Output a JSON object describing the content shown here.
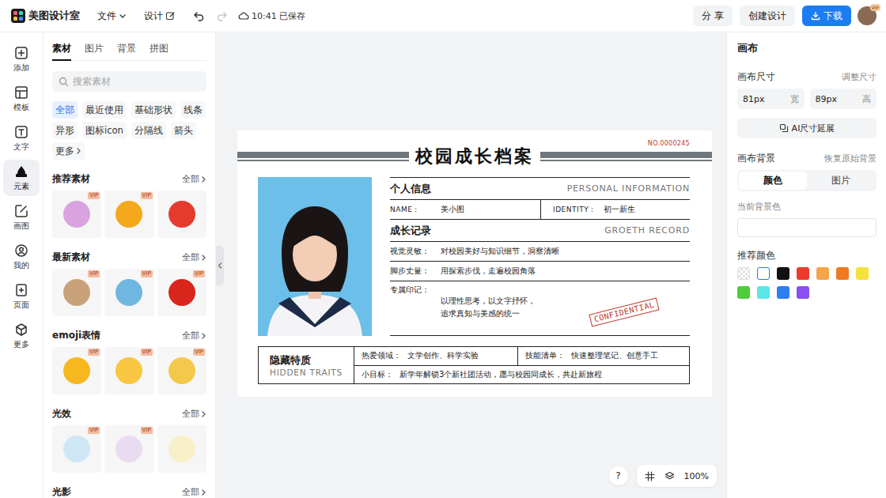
{
  "topbar": {
    "logo": "美图设计室",
    "menus": [
      {
        "label": "文件",
        "kind": "dropdown"
      },
      {
        "label": "设计",
        "kind": "edit"
      }
    ],
    "history": {
      "undo_disabled": false,
      "redo_disabled": true
    },
    "save_status": "10:41 已保存",
    "share": "分 享",
    "create": "创建设计",
    "download": "下载",
    "avatar_badge": "VIP"
  },
  "rail": [
    {
      "label": "添加",
      "selected": false
    },
    {
      "label": "模板",
      "selected": false
    },
    {
      "label": "文字",
      "selected": false
    },
    {
      "label": "元素",
      "selected": true
    },
    {
      "label": "画图",
      "selected": false
    },
    {
      "label": "我的",
      "selected": false
    },
    {
      "label": "页面",
      "selected": false
    },
    {
      "label": "更多",
      "selected": false
    }
  ],
  "panel": {
    "tabs": [
      {
        "label": "素材",
        "selected": true
      },
      {
        "label": "图片",
        "selected": false
      },
      {
        "label": "背景",
        "selected": false
      },
      {
        "label": "拼图",
        "selected": false
      }
    ],
    "search": {
      "placeholder": "搜索素材"
    },
    "chips": [
      {
        "label": "全部",
        "selected": true,
        "kind": "plain"
      },
      {
        "label": "最近使用",
        "selected": false,
        "kind": "plain"
      },
      {
        "label": "基础形状",
        "selected": false,
        "kind": "plain"
      },
      {
        "label": "线条",
        "selected": false,
        "kind": "plain"
      },
      {
        "label": "异形",
        "selected": false,
        "kind": "plain"
      },
      {
        "label": "图标icon",
        "selected": false,
        "kind": "plain"
      },
      {
        "label": "分隔线",
        "selected": false,
        "kind": "plain"
      },
      {
        "label": "箭头",
        "selected": false,
        "kind": "plain"
      },
      {
        "label": "更多",
        "selected": false,
        "kind": "more"
      }
    ],
    "sections": [
      {
        "title": "推荐素材",
        "more": "全部",
        "items": [
          {
            "badge": "VIP",
            "color": "#d9a3e0"
          },
          {
            "badge": "VIP",
            "color": "#f4a81c"
          },
          {
            "badge": null,
            "color": "#e53a2c"
          }
        ]
      },
      {
        "title": "最新素材",
        "more": "全部",
        "items": [
          {
            "badge": "VIP",
            "color": "#c9a27a"
          },
          {
            "badge": "VIP",
            "color": "#6fb7e0"
          },
          {
            "badge": "VIP",
            "color": "#d8261c"
          }
        ]
      },
      {
        "title": "emoji表情",
        "more": "全部",
        "items": [
          {
            "badge": "VIP",
            "color": "#f6b81c"
          },
          {
            "badge": "VIP",
            "color": "#f8c640"
          },
          {
            "badge": "VIP",
            "color": "#f4c84a"
          }
        ]
      },
      {
        "title": "光效",
        "more": "全部",
        "items": [
          {
            "badge": "VIP",
            "color": "#cfe6f5"
          },
          {
            "badge": "VIP",
            "color": "#eadcf0"
          },
          {
            "badge": null,
            "color": "#f7f0c8"
          }
        ]
      },
      {
        "title": "光影",
        "more": "全部",
        "items": [
          {
            "badge": null,
            "color": "#cccccc"
          },
          {
            "badge": null,
            "color": "#dddddd"
          },
          {
            "badge": null,
            "color": "#e0d0b0"
          }
        ]
      }
    ]
  },
  "canvas": {
    "doc": {
      "serial": "NO.0000245",
      "title": "校园成长档案",
      "info": {
        "title": "个人信息",
        "title_en": "PERSONAL INFORMATION",
        "fields": [
          {
            "label": "NAME：",
            "value": "美小图"
          },
          {
            "label": "IDENTITY：",
            "value": "初一新生"
          }
        ]
      },
      "record": {
        "title": "成长记录",
        "title_en": "GROETH RECORD",
        "rows": [
          {
            "label": "视觉灵敏：",
            "kind": "inline",
            "lines": [
              "对校园美好与知识细节，洞察清晰"
            ]
          },
          {
            "label": "脚步丈量：",
            "kind": "inline",
            "lines": [
              "用探索步伐，走遍校园角落"
            ]
          },
          {
            "label": "专属印记：",
            "kind": "block",
            "lines": [
              "以理性思考，以文字抒怀，",
              "追求真知与美感的统一"
            ]
          }
        ]
      },
      "stamp": "CONFIDENTIAL",
      "traits": {
        "title": "隐藏特质",
        "title_en": "HIDDEN TRAITS",
        "cells": [
          {
            "label": "热爱领域：",
            "value": "文学创作、科学实验"
          },
          {
            "label": "技能清单：",
            "value": "快速整理笔记、创意手工"
          },
          {
            "label": "小目标：",
            "value": "新学年解锁3个新社团活动，愿与校园同成长，共赴新旅程"
          }
        ]
      }
    },
    "help": "?",
    "zoom": "100%"
  },
  "inspector": {
    "title": "画布",
    "size": {
      "label": "画布尺寸",
      "action": "调整尺寸",
      "fields": [
        {
          "value": "81px",
          "unit": "宽"
        },
        {
          "value": "89px",
          "unit": "高"
        }
      ]
    },
    "ai_button": "AI尺寸延展",
    "background": {
      "label": "画布背景",
      "action": "恢复原始背景",
      "modes": [
        {
          "label": "颜色",
          "selected": true
        },
        {
          "label": "图片",
          "selected": false
        }
      ],
      "current_label": "当前背景色",
      "recommended_label": "推荐颜色",
      "swatches": [
        {
          "kind": "transparent",
          "color": "#ffffff",
          "selected": false
        },
        {
          "kind": "solid",
          "color": "#ffffff",
          "selected": true
        },
        {
          "kind": "solid",
          "color": "#111111",
          "selected": false
        },
        {
          "kind": "solid",
          "color": "#ee3a2a",
          "selected": false
        },
        {
          "kind": "solid",
          "color": "#f5a54a",
          "selected": false
        },
        {
          "kind": "solid",
          "color": "#f07a22",
          "selected": false
        },
        {
          "kind": "solid",
          "color": "#f7e13c",
          "selected": false
        },
        {
          "kind": "solid",
          "color": "#4fcc3c",
          "selected": false
        },
        {
          "kind": "solid",
          "color": "#5be7e7",
          "selected": false
        },
        {
          "kind": "solid",
          "color": "#2d7ff0",
          "selected": false
        },
        {
          "kind": "solid",
          "color": "#8a4ff0",
          "selected": false
        }
      ]
    }
  }
}
